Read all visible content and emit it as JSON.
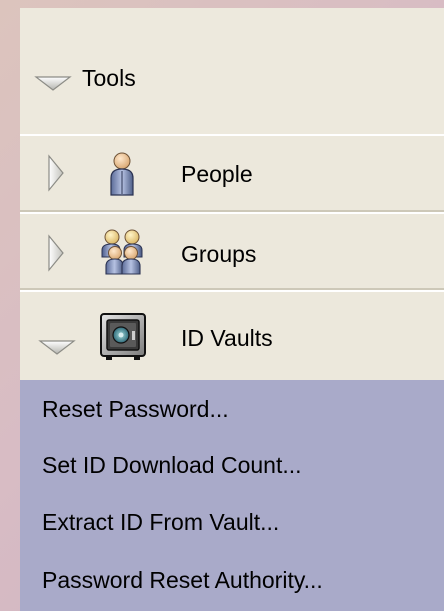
{
  "tools": {
    "label": "Tools",
    "icon": "chevron-down-icon"
  },
  "sections": [
    {
      "label": "People",
      "icon": "person-icon",
      "expanded": false
    },
    {
      "label": "Groups",
      "icon": "group-icon",
      "expanded": false
    },
    {
      "label": "ID Vaults",
      "icon": "vault-icon",
      "expanded": true
    }
  ],
  "id_vault_actions": [
    "Reset Password...",
    "Set ID Download Count...",
    "Extract ID From Vault...",
    "Password Reset Authority..."
  ],
  "colors": {
    "panel_bg": "#ece8dc",
    "menu_bg": "#a9aac9"
  }
}
